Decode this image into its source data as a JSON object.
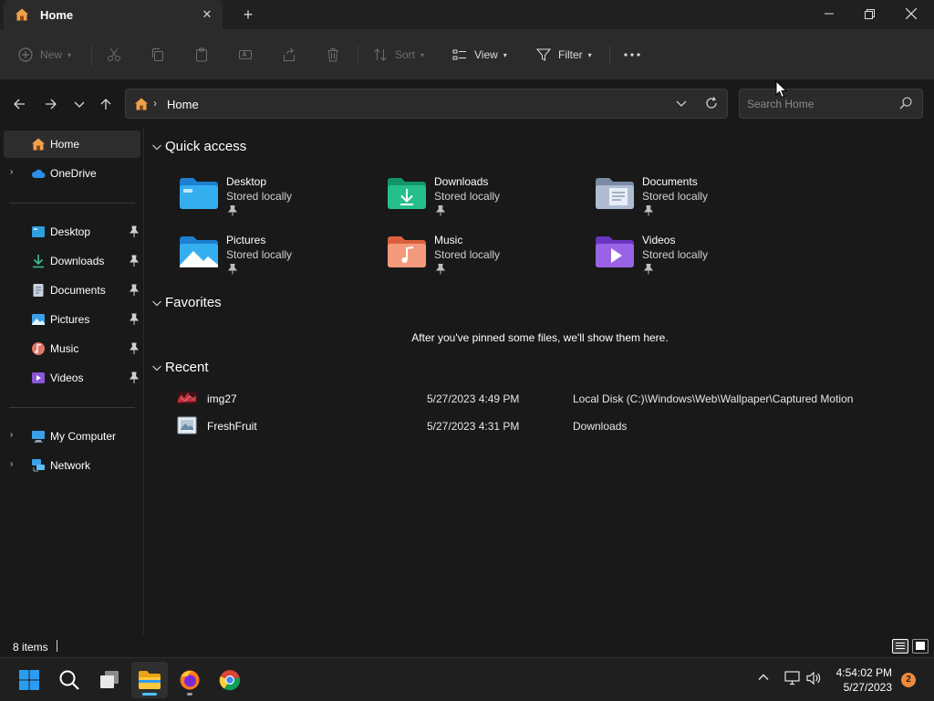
{
  "window": {
    "tab_title": "Home",
    "tab_icon": "home-icon",
    "new_tab_label": "+"
  },
  "toolbar": {
    "new_label": "New",
    "sort_label": "Sort",
    "view_label": "View",
    "filter_label": "Filter"
  },
  "address": {
    "crumb": "Home",
    "search_placeholder": "Search Home"
  },
  "sidebar": {
    "top_items": [
      {
        "label": "Home",
        "icon": "home-icon",
        "selected": true
      },
      {
        "label": "OneDrive",
        "icon": "cloud-icon",
        "expandable": true
      }
    ],
    "pinned_items": [
      {
        "label": "Desktop",
        "icon": "desktop-folder-icon"
      },
      {
        "label": "Downloads",
        "icon": "download-icon"
      },
      {
        "label": "Documents",
        "icon": "documents-icon"
      },
      {
        "label": "Pictures",
        "icon": "pictures-icon"
      },
      {
        "label": "Music",
        "icon": "music-icon"
      },
      {
        "label": "Videos",
        "icon": "videos-icon"
      }
    ],
    "bottom_items": [
      {
        "label": "My Computer",
        "icon": "computer-icon",
        "expandable": true
      },
      {
        "label": "Network",
        "icon": "network-icon",
        "expandable": true
      }
    ]
  },
  "content": {
    "quick_access_title": "Quick access",
    "quick_access": [
      {
        "name": "Desktop",
        "sub": "Stored locally",
        "icon": "desktop-folder-icon"
      },
      {
        "name": "Downloads",
        "sub": "Stored locally",
        "icon": "downloads-folder-icon"
      },
      {
        "name": "Documents",
        "sub": "Stored locally",
        "icon": "documents-folder-icon"
      },
      {
        "name": "Pictures",
        "sub": "Stored locally",
        "icon": "pictures-folder-icon"
      },
      {
        "name": "Music",
        "sub": "Stored locally",
        "icon": "music-folder-icon"
      },
      {
        "name": "Videos",
        "sub": "Stored locally",
        "icon": "videos-folder-icon"
      }
    ],
    "favorites_title": "Favorites",
    "favorites_empty": "After you've pinned some files, we'll show them here.",
    "recent_title": "Recent",
    "recent": [
      {
        "name": "img27",
        "date": "5/27/2023 4:49 PM",
        "location": "Local Disk (C:)\\Windows\\Web\\Wallpaper\\Captured Motion",
        "icon": "image-thumbnail-icon"
      },
      {
        "name": "FreshFruit",
        "date": "5/27/2023 4:31 PM",
        "location": "Downloads",
        "icon": "image-file-icon"
      }
    ]
  },
  "status": {
    "item_count": "8 items"
  },
  "taskbar": {
    "apps": [
      "start-icon",
      "search-icon",
      "task-view-icon",
      "file-explorer-icon",
      "firefox-icon",
      "chrome-icon"
    ],
    "time": "4:54:02 PM",
    "date": "5/27/2023",
    "notification_count": "2"
  },
  "colors": {
    "background": "#191919",
    "toolbar": "#2b2b2b",
    "accent": "#f08a3c"
  }
}
